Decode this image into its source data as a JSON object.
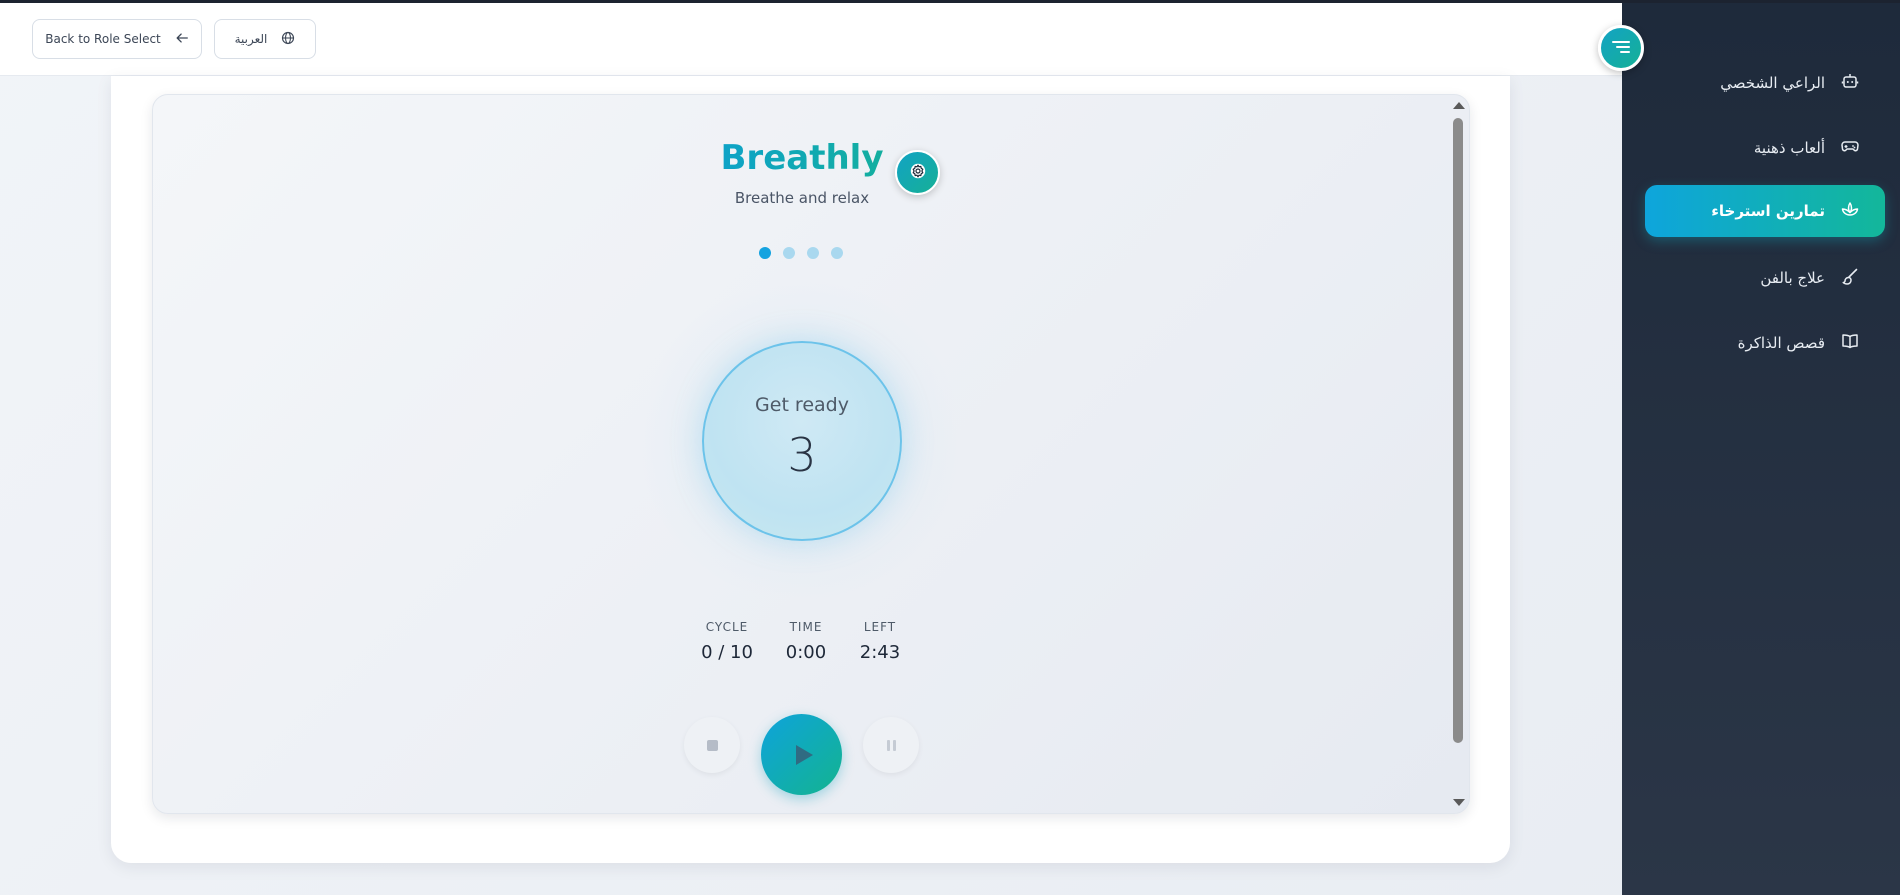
{
  "header": {
    "back_label": "Back to Role Select",
    "lang_label": "العربية"
  },
  "sidebar": {
    "items": [
      {
        "label": "الراعي الشخصي",
        "icon": "robot-icon",
        "active": false
      },
      {
        "label": "ألعاب ذهنية",
        "icon": "gamepad-icon",
        "active": false
      },
      {
        "label": "تمارين استرخاء",
        "icon": "lotus-icon",
        "active": true
      },
      {
        "label": "علاج بالفن",
        "icon": "brush-icon",
        "active": false
      },
      {
        "label": "قصص الذاكرة",
        "icon": "book-icon",
        "active": false
      }
    ]
  },
  "app": {
    "title": "Breathly",
    "subtitle": "Breathe and relax",
    "pager": {
      "total": 4,
      "current": 1
    },
    "breath": {
      "phase": "Get ready",
      "count": "3"
    },
    "stats": [
      {
        "label": "CYCLE",
        "value": "0 / 10"
      },
      {
        "label": "TIME",
        "value": "0:00"
      },
      {
        "label": "LEFT",
        "value": "2:43"
      }
    ]
  },
  "colors": {
    "accent_start": "#0ea5dc",
    "accent_end": "#13b79a",
    "sidebar_bg": "#1e2a3b"
  }
}
